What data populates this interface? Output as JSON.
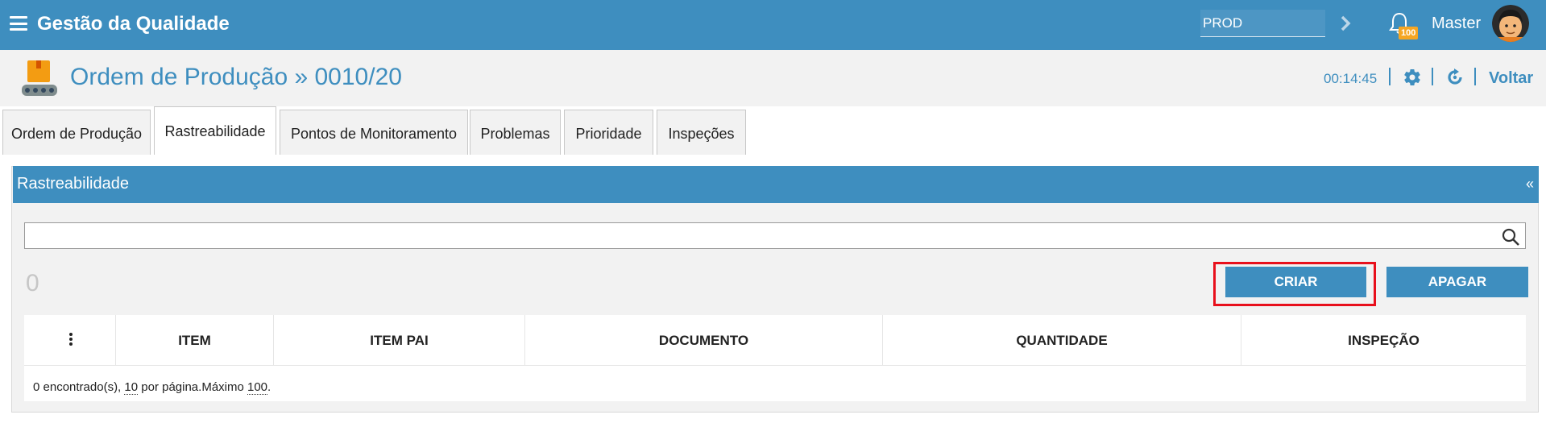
{
  "topbar": {
    "app_title": "Gestão da Qualidade",
    "env_value": "PROD",
    "notifications_badge": "100",
    "user_name": "Master"
  },
  "header": {
    "title": "Ordem de Produção » 0010/20",
    "timer": "00:14:45",
    "back_label": "Voltar"
  },
  "tabs": [
    {
      "label": "Ordem de Produção"
    },
    {
      "label": "Rastreabilidade"
    },
    {
      "label": "Pontos de Monitoramento"
    },
    {
      "label": "Problemas"
    },
    {
      "label": "Prioridade"
    },
    {
      "label": "Inspeções"
    }
  ],
  "panel": {
    "title": "Rastreabilidade",
    "collapse_label": "«",
    "search_value": "",
    "count": "0",
    "create_label": "CRIAR",
    "delete_label": "APAGAR"
  },
  "table": {
    "columns": [
      "ITEM",
      "ITEM PAI",
      "DOCUMENTO",
      "QUANTIDADE",
      "INSPEÇÃO"
    ],
    "footer": {
      "found": "0 encontrado(s), ",
      "per_page": "10",
      "per_page_suffix": " por página.Máximo ",
      "max": "100",
      "end": "."
    }
  },
  "colors": {
    "primary": "#3e8ebf",
    "highlight": "#e8101c",
    "badge": "#f5a623"
  }
}
